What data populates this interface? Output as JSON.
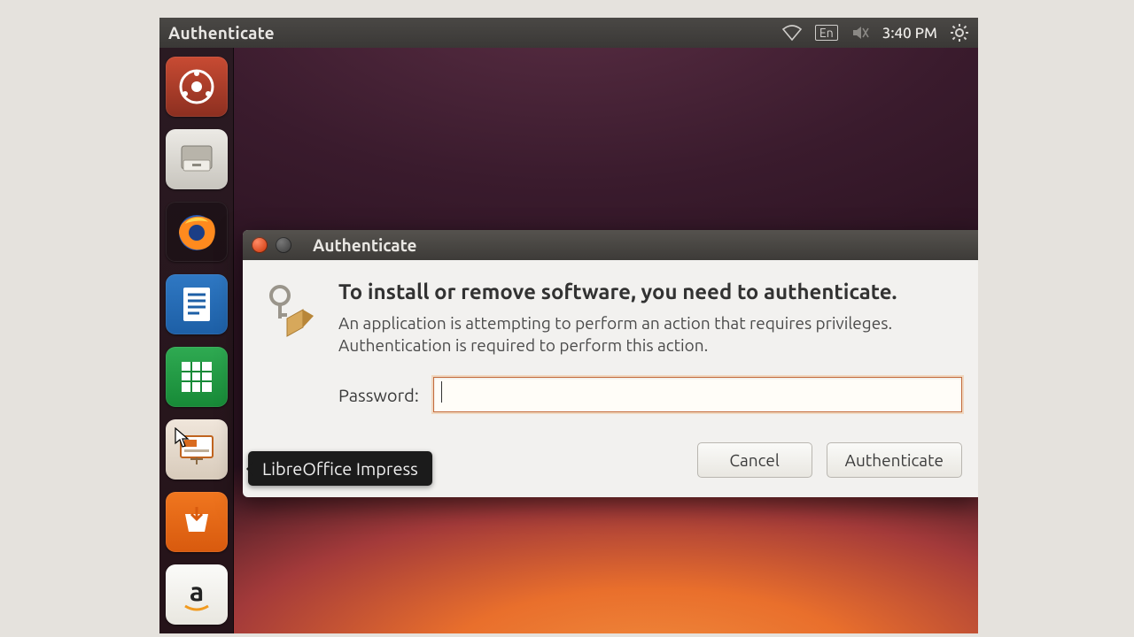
{
  "menubar": {
    "title": "Authenticate",
    "lang": "En",
    "time": "3:40 PM"
  },
  "launcher": {
    "items": [
      {
        "name": "dash-icon"
      },
      {
        "name": "files-icon"
      },
      {
        "name": "firefox-icon"
      },
      {
        "name": "writer-icon"
      },
      {
        "name": "calc-icon"
      },
      {
        "name": "impress-icon"
      },
      {
        "name": "software-center-icon"
      },
      {
        "name": "amazon-icon"
      }
    ]
  },
  "tooltip": {
    "text": "LibreOffice Impress"
  },
  "dialog": {
    "title": "Authenticate",
    "heading": "To install or remove software, you need to authenticate.",
    "description": "An application is attempting to perform an action that requires privileges. Authentication is required to perform this action.",
    "password_label": "Password:",
    "password_value": "",
    "cancel_label": "Cancel",
    "authenticate_label": "Authenticate"
  },
  "colors": {
    "accent": "#e96f2c"
  }
}
